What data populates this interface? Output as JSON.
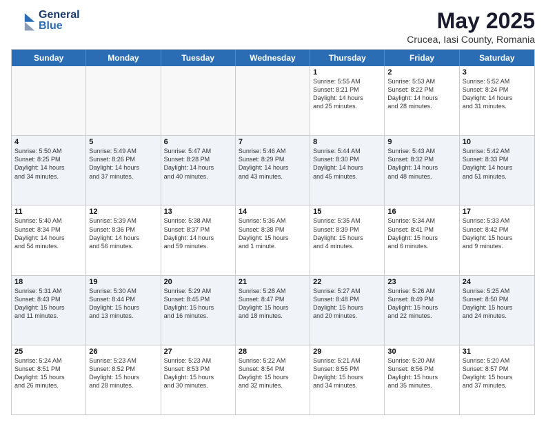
{
  "header": {
    "logo_general": "General",
    "logo_blue": "Blue",
    "title": "May 2025",
    "subtitle": "Crucea, Iasi County, Romania"
  },
  "days_of_week": [
    "Sunday",
    "Monday",
    "Tuesday",
    "Wednesday",
    "Thursday",
    "Friday",
    "Saturday"
  ],
  "weeks": [
    [
      {
        "num": "",
        "info": "",
        "empty": true
      },
      {
        "num": "",
        "info": "",
        "empty": true
      },
      {
        "num": "",
        "info": "",
        "empty": true
      },
      {
        "num": "",
        "info": "",
        "empty": true
      },
      {
        "num": "1",
        "info": "Sunrise: 5:55 AM\nSunset: 8:21 PM\nDaylight: 14 hours\nand 25 minutes.",
        "empty": false
      },
      {
        "num": "2",
        "info": "Sunrise: 5:53 AM\nSunset: 8:22 PM\nDaylight: 14 hours\nand 28 minutes.",
        "empty": false
      },
      {
        "num": "3",
        "info": "Sunrise: 5:52 AM\nSunset: 8:24 PM\nDaylight: 14 hours\nand 31 minutes.",
        "empty": false
      }
    ],
    [
      {
        "num": "4",
        "info": "Sunrise: 5:50 AM\nSunset: 8:25 PM\nDaylight: 14 hours\nand 34 minutes.",
        "empty": false
      },
      {
        "num": "5",
        "info": "Sunrise: 5:49 AM\nSunset: 8:26 PM\nDaylight: 14 hours\nand 37 minutes.",
        "empty": false
      },
      {
        "num": "6",
        "info": "Sunrise: 5:47 AM\nSunset: 8:28 PM\nDaylight: 14 hours\nand 40 minutes.",
        "empty": false
      },
      {
        "num": "7",
        "info": "Sunrise: 5:46 AM\nSunset: 8:29 PM\nDaylight: 14 hours\nand 43 minutes.",
        "empty": false
      },
      {
        "num": "8",
        "info": "Sunrise: 5:44 AM\nSunset: 8:30 PM\nDaylight: 14 hours\nand 45 minutes.",
        "empty": false
      },
      {
        "num": "9",
        "info": "Sunrise: 5:43 AM\nSunset: 8:32 PM\nDaylight: 14 hours\nand 48 minutes.",
        "empty": false
      },
      {
        "num": "10",
        "info": "Sunrise: 5:42 AM\nSunset: 8:33 PM\nDaylight: 14 hours\nand 51 minutes.",
        "empty": false
      }
    ],
    [
      {
        "num": "11",
        "info": "Sunrise: 5:40 AM\nSunset: 8:34 PM\nDaylight: 14 hours\nand 54 minutes.",
        "empty": false
      },
      {
        "num": "12",
        "info": "Sunrise: 5:39 AM\nSunset: 8:36 PM\nDaylight: 14 hours\nand 56 minutes.",
        "empty": false
      },
      {
        "num": "13",
        "info": "Sunrise: 5:38 AM\nSunset: 8:37 PM\nDaylight: 14 hours\nand 59 minutes.",
        "empty": false
      },
      {
        "num": "14",
        "info": "Sunrise: 5:36 AM\nSunset: 8:38 PM\nDaylight: 15 hours\nand 1 minute.",
        "empty": false
      },
      {
        "num": "15",
        "info": "Sunrise: 5:35 AM\nSunset: 8:39 PM\nDaylight: 15 hours\nand 4 minutes.",
        "empty": false
      },
      {
        "num": "16",
        "info": "Sunrise: 5:34 AM\nSunset: 8:41 PM\nDaylight: 15 hours\nand 6 minutes.",
        "empty": false
      },
      {
        "num": "17",
        "info": "Sunrise: 5:33 AM\nSunset: 8:42 PM\nDaylight: 15 hours\nand 9 minutes.",
        "empty": false
      }
    ],
    [
      {
        "num": "18",
        "info": "Sunrise: 5:31 AM\nSunset: 8:43 PM\nDaylight: 15 hours\nand 11 minutes.",
        "empty": false
      },
      {
        "num": "19",
        "info": "Sunrise: 5:30 AM\nSunset: 8:44 PM\nDaylight: 15 hours\nand 13 minutes.",
        "empty": false
      },
      {
        "num": "20",
        "info": "Sunrise: 5:29 AM\nSunset: 8:45 PM\nDaylight: 15 hours\nand 16 minutes.",
        "empty": false
      },
      {
        "num": "21",
        "info": "Sunrise: 5:28 AM\nSunset: 8:47 PM\nDaylight: 15 hours\nand 18 minutes.",
        "empty": false
      },
      {
        "num": "22",
        "info": "Sunrise: 5:27 AM\nSunset: 8:48 PM\nDaylight: 15 hours\nand 20 minutes.",
        "empty": false
      },
      {
        "num": "23",
        "info": "Sunrise: 5:26 AM\nSunset: 8:49 PM\nDaylight: 15 hours\nand 22 minutes.",
        "empty": false
      },
      {
        "num": "24",
        "info": "Sunrise: 5:25 AM\nSunset: 8:50 PM\nDaylight: 15 hours\nand 24 minutes.",
        "empty": false
      }
    ],
    [
      {
        "num": "25",
        "info": "Sunrise: 5:24 AM\nSunset: 8:51 PM\nDaylight: 15 hours\nand 26 minutes.",
        "empty": false
      },
      {
        "num": "26",
        "info": "Sunrise: 5:23 AM\nSunset: 8:52 PM\nDaylight: 15 hours\nand 28 minutes.",
        "empty": false
      },
      {
        "num": "27",
        "info": "Sunrise: 5:23 AM\nSunset: 8:53 PM\nDaylight: 15 hours\nand 30 minutes.",
        "empty": false
      },
      {
        "num": "28",
        "info": "Sunrise: 5:22 AM\nSunset: 8:54 PM\nDaylight: 15 hours\nand 32 minutes.",
        "empty": false
      },
      {
        "num": "29",
        "info": "Sunrise: 5:21 AM\nSunset: 8:55 PM\nDaylight: 15 hours\nand 34 minutes.",
        "empty": false
      },
      {
        "num": "30",
        "info": "Sunrise: 5:20 AM\nSunset: 8:56 PM\nDaylight: 15 hours\nand 35 minutes.",
        "empty": false
      },
      {
        "num": "31",
        "info": "Sunrise: 5:20 AM\nSunset: 8:57 PM\nDaylight: 15 hours\nand 37 minutes.",
        "empty": false
      }
    ]
  ]
}
